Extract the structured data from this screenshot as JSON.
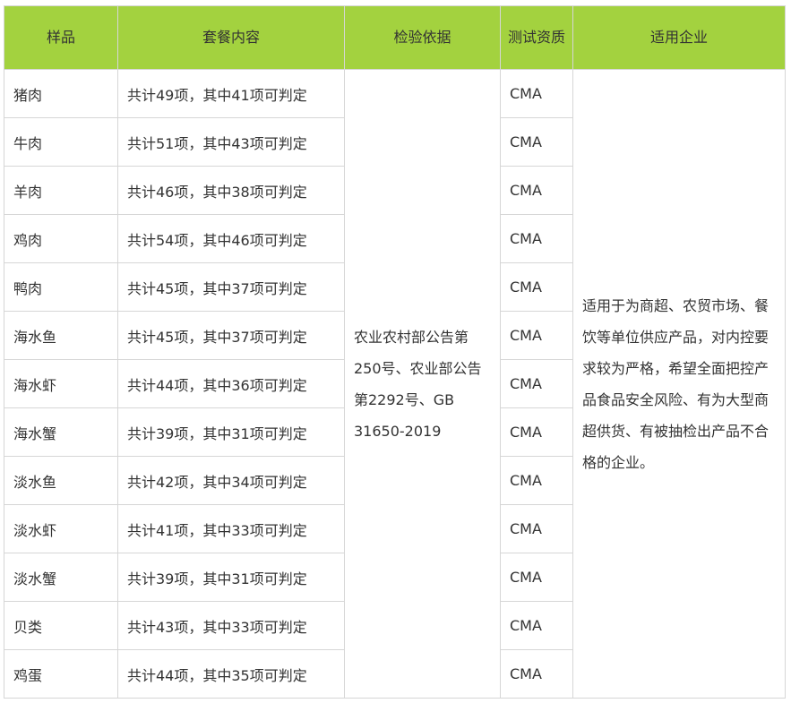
{
  "headers": {
    "sample": "样品",
    "package": "套餐内容",
    "basis": "检验依据",
    "qualification": "测试资质",
    "applicable": "适用企业"
  },
  "rows": [
    {
      "sample": "猪肉",
      "package": "共计49项，其中41项可判定",
      "qual": "CMA"
    },
    {
      "sample": "牛肉",
      "package": "共计51项，其中43项可判定",
      "qual": "CMA"
    },
    {
      "sample": "羊肉",
      "package": "共计46项，其中38项可判定",
      "qual": "CMA"
    },
    {
      "sample": "鸡肉",
      "package": "共计54项，其中46项可判定",
      "qual": "CMA"
    },
    {
      "sample": "鸭肉",
      "package": "共计45项，其中37项可判定",
      "qual": "CMA"
    },
    {
      "sample": "海水鱼",
      "package": "共计45项，其中37项可判定",
      "qual": "CMA"
    },
    {
      "sample": "海水虾",
      "package": "共计44项，其中36项可判定",
      "qual": "CMA"
    },
    {
      "sample": "海水蟹",
      "package": "共计39项，其中31项可判定",
      "qual": "CMA"
    },
    {
      "sample": "淡水鱼",
      "package": "共计42项，其中34项可判定",
      "qual": "CMA"
    },
    {
      "sample": "淡水虾",
      "package": "共计41项，其中33项可判定",
      "qual": "CMA"
    },
    {
      "sample": "淡水蟹",
      "package": "共计39项，其中31项可判定",
      "qual": "CMA"
    },
    {
      "sample": "贝类",
      "package": "共计43项，其中33项可判定",
      "qual": "CMA"
    },
    {
      "sample": "鸡蛋",
      "package": "共计44项，其中35项可判定",
      "qual": "CMA"
    }
  ],
  "basis_text": "农业农村部公告第250号、农业部公告第2292号、GB 31650-2019",
  "applicable_text": "适用于为商超、农贸市场、餐饮等单位供应产品，对内控要求较为严格，希望全面把控产品食品安全风险、有为大型商超供货、有被抽检出产品不合格的企业。",
  "colors": {
    "header_bg": "#a3d23f",
    "border": "#d6d6d6",
    "text": "#333333"
  }
}
